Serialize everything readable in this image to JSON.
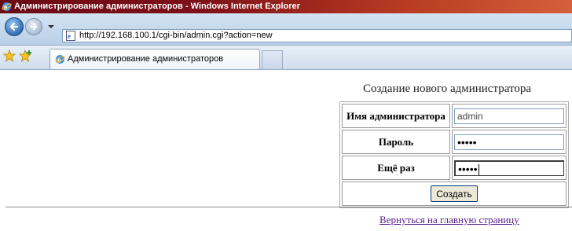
{
  "window": {
    "title": "Администрирование администраторов - Windows Internet Explorer"
  },
  "address_bar": {
    "url": "http://192.168.100.1/cgi-bin/admin.cgi?action=new"
  },
  "tabs": [
    {
      "label": "Администрирование администраторов",
      "active": true
    }
  ],
  "page": {
    "heading": "Создание нового администратора",
    "form": {
      "fields": [
        {
          "label": "Имя администратора",
          "value": "admin",
          "type": "text"
        },
        {
          "label": "Пароль",
          "value": "•••••",
          "type": "password"
        },
        {
          "label": "Ещё раз",
          "value": "•••••",
          "type": "password",
          "focused": true
        }
      ],
      "submit_label": "Создать"
    },
    "home_link": "Вернуться на главную страницу"
  },
  "colors": {
    "titlebar": "#7d1018",
    "link_visited": "#551a8b"
  },
  "icons": [
    "ie-logo-icon",
    "back-arrow-icon",
    "forward-arrow-icon",
    "page-icon",
    "favorites-star-icon",
    "add-favorite-icon",
    "tab-ie-icon"
  ]
}
